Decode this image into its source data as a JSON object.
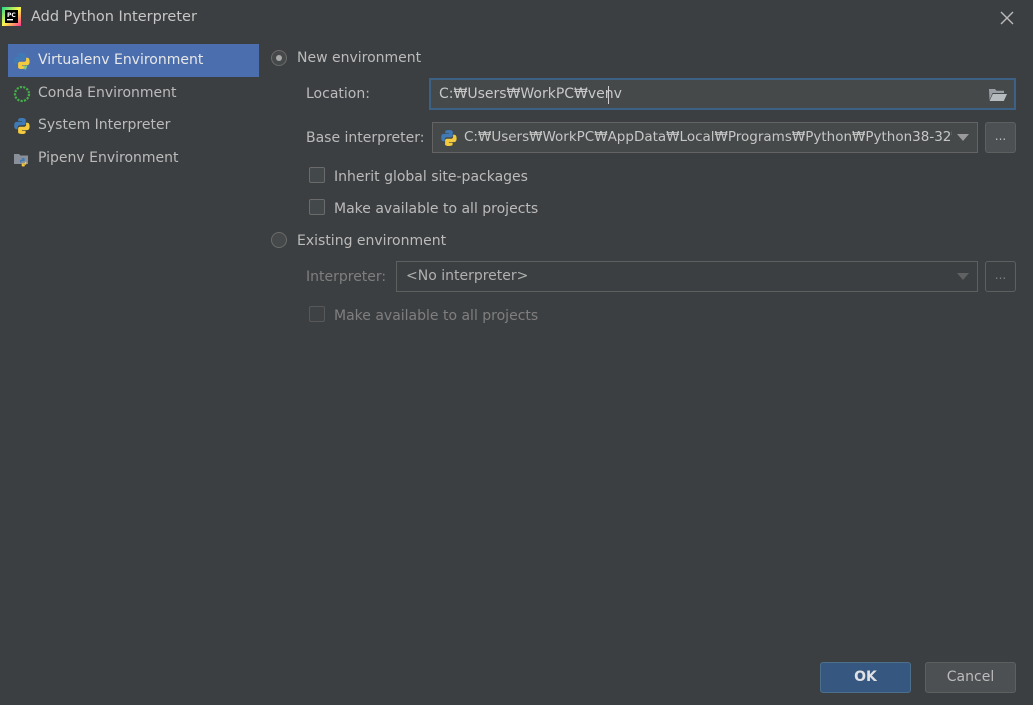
{
  "window": {
    "title": "Add Python Interpreter"
  },
  "sidebar": {
    "items": [
      {
        "label": "Virtualenv Environment",
        "icon": "virtualenv-icon",
        "selected": true
      },
      {
        "label": "Conda Environment",
        "icon": "conda-icon",
        "selected": false
      },
      {
        "label": "System Interpreter",
        "icon": "python-icon",
        "selected": false
      },
      {
        "label": "Pipenv Environment",
        "icon": "pipenv-icon",
        "selected": false
      }
    ]
  },
  "new_env": {
    "radio_label": "New environment",
    "location_label": "Location:",
    "location_value": "C:₩Users₩WorkPC₩venv",
    "base_label": "Base interpreter:",
    "base_value": "C:₩Users₩WorkPC₩AppData₩Local₩Programs₩Python₩Python38-32₩",
    "inherit_label": "Inherit global site-packages",
    "make_available_label": "Make available to all projects",
    "browse_label": "..."
  },
  "existing_env": {
    "radio_label": "Existing environment",
    "interpreter_label": "Interpreter:",
    "interpreter_value": "<No interpreter>",
    "make_available_label": "Make available to all projects",
    "browse_label": "..."
  },
  "footer": {
    "ok_label": "OK",
    "cancel_label": "Cancel"
  },
  "colors": {
    "accent": "#4b6eaf",
    "primary_button": "#365880",
    "background": "#3c3f41"
  }
}
